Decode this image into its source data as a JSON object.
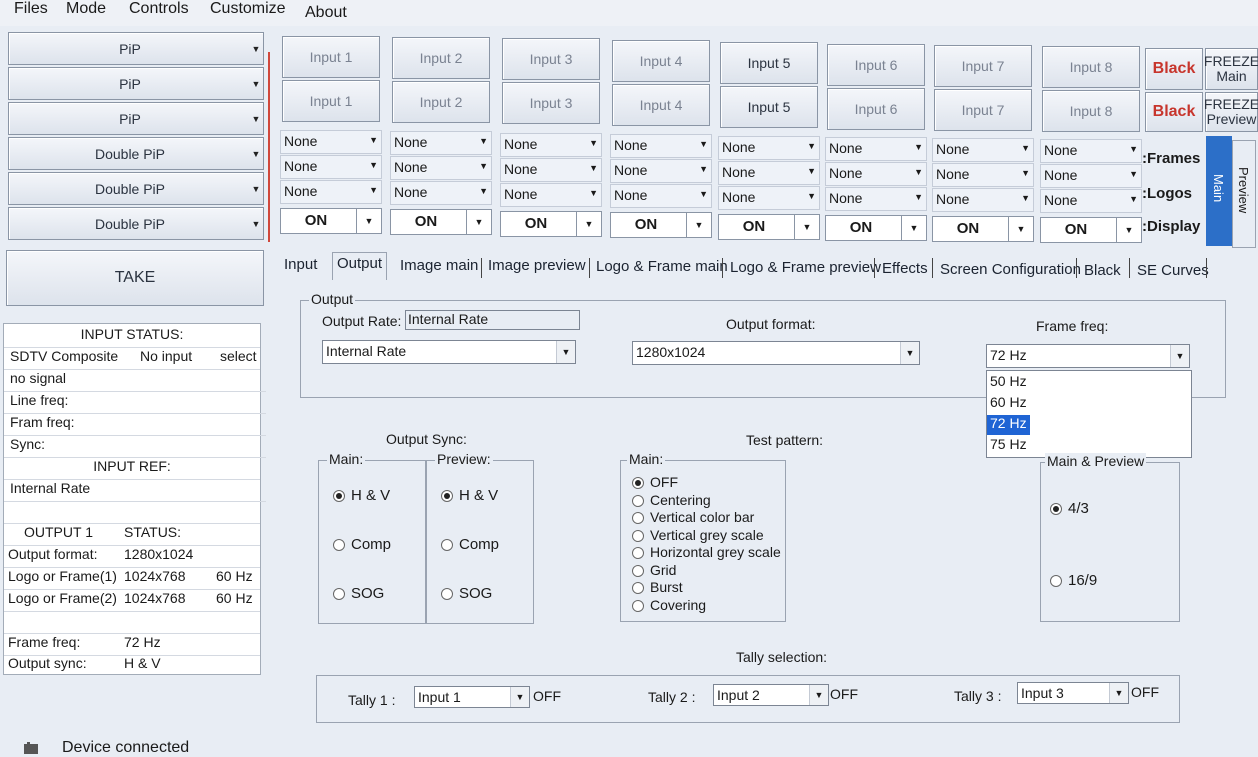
{
  "menu": [
    "Files",
    "Mode",
    "Controls",
    "Customize",
    "About"
  ],
  "pip_buttons": [
    "PiP",
    "PiP",
    "PiP",
    "Double PiP",
    "Double PiP",
    "Double PiP"
  ],
  "take_label": "TAKE",
  "inputs_row1": [
    "Input 1",
    "Input 2",
    "Input 3",
    "Input 4",
    "Input 5",
    "Input 6",
    "Input 7",
    "Input 8"
  ],
  "inputs_row2": [
    "Input 1",
    "Input 2",
    "Input 3",
    "Input 4",
    "Input 5",
    "Input 6",
    "Input 7",
    "Input 8"
  ],
  "black_main": "Black",
  "black_preview": "Black",
  "freeze_main": [
    "FREEZE",
    "Main"
  ],
  "freeze_preview": [
    "FREEZE",
    "Preview"
  ],
  "selector_value": "None",
  "on_label": "ON",
  "side_labels": [
    ":Frames",
    ":Logos",
    ":Display"
  ],
  "vertical_tabs": {
    "main": "Main",
    "preview": "Preview"
  },
  "tabs": [
    "Input",
    "Output",
    "Image main",
    "Image preview",
    "Logo & Frame main",
    "Logo & Frame preview",
    "Effects",
    "Screen Configuration",
    "Black",
    "SE Curves"
  ],
  "active_tab": "Output",
  "status": {
    "input_status_title": "INPUT STATUS:",
    "sdtv": "SDTV Composite",
    "no_input": "No input",
    "select": "select",
    "no_signal": "no signal",
    "line_freq": "Line freq:",
    "fram_freq": "Fram freq:",
    "sync": "Sync:",
    "input_ref_title": "INPUT REF:",
    "internal_rate": "Internal Rate",
    "output1": "OUTPUT 1",
    "status_label": "STATUS:",
    "output_format_label": "Output format:",
    "output_format_value": "1280x1024",
    "logo1_label": "Logo or Frame(1)",
    "logo1_res": "1024x768",
    "logo1_hz": "60 Hz",
    "logo2_label": "Logo or Frame(2)",
    "logo2_res": "1024x768",
    "logo2_hz": "60 Hz",
    "frame_freq_label": "Frame freq:",
    "frame_freq_value": "72 Hz",
    "output_sync_label": "Output sync:",
    "output_sync_value": "H & V"
  },
  "output": {
    "group_title": "Output",
    "rate_label": "Output Rate:",
    "rate_value": "Internal Rate",
    "rate_combo": "Internal Rate",
    "format_label": "Output format:",
    "format_value": "1280x1024",
    "freq_label": "Frame freq:",
    "freq_value": "72 Hz",
    "freq_options": [
      "50 Hz",
      "60 Hz",
      "72 Hz",
      "75 Hz"
    ],
    "freq_selected_index": 2
  },
  "sync": {
    "title": "Output Sync:",
    "main_title": "Main:",
    "preview_title": "Preview:",
    "options": [
      "H & V",
      "Comp",
      "SOG"
    ]
  },
  "test_pattern": {
    "title": "Test pattern:",
    "main_title": "Main:",
    "options": [
      "OFF",
      "Centering",
      "Vertical color bar",
      "Vertical grey scale",
      "Horizontal grey scale",
      "Grid",
      "Burst",
      "Covering"
    ]
  },
  "aspect": {
    "title": "Main & Preview",
    "options": [
      "4/3",
      "16/9"
    ]
  },
  "tally": {
    "title": "Tally selection:",
    "items": [
      {
        "label": "Tally 1 :",
        "value": "Input 1",
        "state": "OFF"
      },
      {
        "label": "Tally 2 :",
        "value": "Input 2",
        "state": "OFF"
      },
      {
        "label": "Tally 3 :",
        "value": "Input 3",
        "state": "OFF"
      }
    ]
  },
  "statusbar": "Device connected"
}
